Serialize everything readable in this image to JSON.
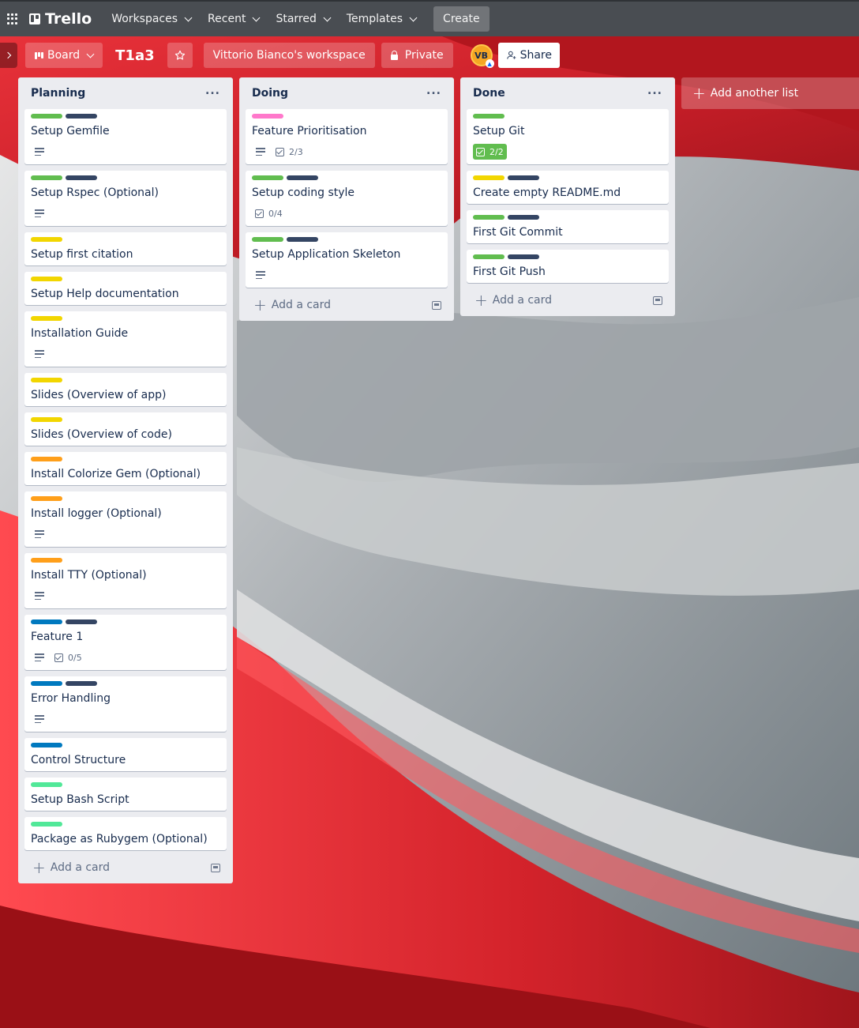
{
  "nav": {
    "workspaces": "Workspaces",
    "recent": "Recent",
    "starred": "Starred",
    "templates": "Templates",
    "create": "Create",
    "logo": "Trello"
  },
  "board": {
    "view": "Board",
    "title": "T1a3",
    "workspace": "Vittorio Bianco's workspace",
    "visibility": "Private",
    "avatar_initials": "VB",
    "share": "Share"
  },
  "colors": {
    "green": "#61bd4f",
    "navy": "#344563",
    "yellow": "#f2d600",
    "orange": "#ff9f1a",
    "blue": "#0079bf",
    "pink": "#ff78cb",
    "lime": "#51e898"
  },
  "lists": [
    {
      "title": "Planning",
      "add_card": "Add a card",
      "cards": [
        {
          "title": "Setup Gemfile",
          "labels": [
            "green",
            "navy"
          ],
          "description": true
        },
        {
          "title": "Setup Rspec (Optional)",
          "labels": [
            "green",
            "navy"
          ],
          "description": true
        },
        {
          "title": "Setup first citation",
          "labels": [
            "yellow"
          ]
        },
        {
          "title": "Setup Help documentation",
          "labels": [
            "yellow"
          ]
        },
        {
          "title": "Installation Guide",
          "labels": [
            "yellow"
          ],
          "description": true
        },
        {
          "title": "Slides (Overview of app)",
          "labels": [
            "yellow"
          ]
        },
        {
          "title": "Slides (Overview of code)",
          "labels": [
            "yellow"
          ]
        },
        {
          "title": "Install Colorize Gem (Optional)",
          "labels": [
            "orange"
          ]
        },
        {
          "title": "Install logger (Optional)",
          "labels": [
            "orange"
          ],
          "description": true
        },
        {
          "title": "Install TTY (Optional)",
          "labels": [
            "orange"
          ],
          "description": true
        },
        {
          "title": "Feature 1",
          "labels": [
            "blue",
            "navy"
          ],
          "description": true,
          "checklist": "0/5"
        },
        {
          "title": "Error Handling",
          "labels": [
            "blue",
            "navy"
          ],
          "description": true
        },
        {
          "title": "Control Structure",
          "labels": [
            "blue"
          ]
        },
        {
          "title": "Setup Bash Script",
          "labels": [
            "lime"
          ]
        },
        {
          "title": "Package as Rubygem (Optional)",
          "labels": [
            "lime"
          ]
        }
      ]
    },
    {
      "title": "Doing",
      "add_card": "Add a card",
      "cards": [
        {
          "title": "Feature Prioritisation",
          "labels": [
            "pink"
          ],
          "description": true,
          "checklist": "2/3"
        },
        {
          "title": "Setup coding style",
          "labels": [
            "green",
            "navy"
          ],
          "checklist": "0/4"
        },
        {
          "title": "Setup Application Skeleton",
          "labels": [
            "green",
            "navy"
          ],
          "description": true
        }
      ]
    },
    {
      "title": "Done",
      "add_card": "Add a card",
      "cards": [
        {
          "title": "Setup Git",
          "labels": [
            "green"
          ],
          "checklist": "2/2",
          "checklist_complete": true
        },
        {
          "title": "Create empty README.md",
          "labels": [
            "yellow",
            "navy"
          ]
        },
        {
          "title": "First Git Commit",
          "labels": [
            "green",
            "navy"
          ]
        },
        {
          "title": "First Git Push",
          "labels": [
            "green",
            "navy"
          ]
        }
      ]
    }
  ],
  "add_list": "Add another list"
}
